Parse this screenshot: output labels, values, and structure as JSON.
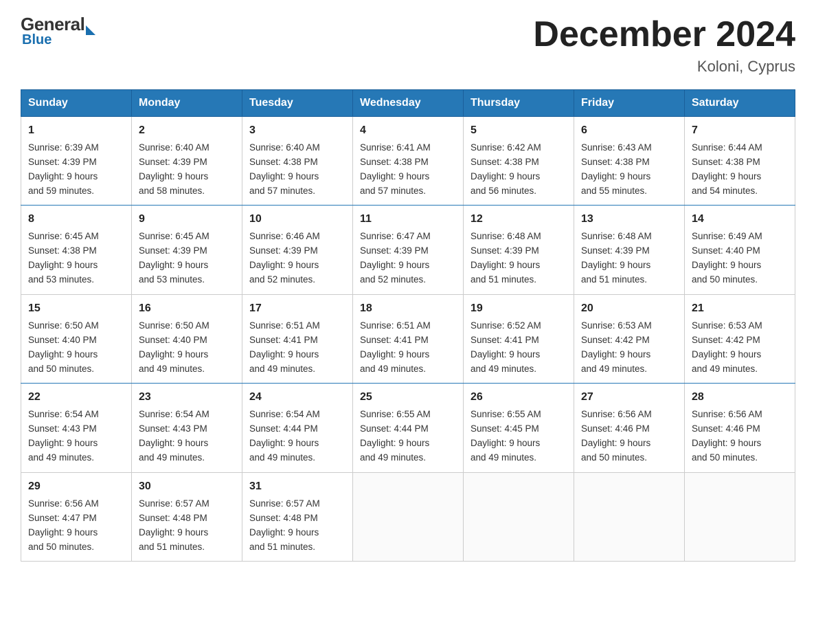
{
  "logo": {
    "general": "General",
    "blue": "Blue"
  },
  "title": "December 2024",
  "location": "Koloni, Cyprus",
  "days_of_week": [
    "Sunday",
    "Monday",
    "Tuesday",
    "Wednesday",
    "Thursday",
    "Friday",
    "Saturday"
  ],
  "weeks": [
    [
      {
        "day": "1",
        "sunrise": "6:39 AM",
        "sunset": "4:39 PM",
        "daylight": "9 hours and 59 minutes."
      },
      {
        "day": "2",
        "sunrise": "6:40 AM",
        "sunset": "4:39 PM",
        "daylight": "9 hours and 58 minutes."
      },
      {
        "day": "3",
        "sunrise": "6:40 AM",
        "sunset": "4:38 PM",
        "daylight": "9 hours and 57 minutes."
      },
      {
        "day": "4",
        "sunrise": "6:41 AM",
        "sunset": "4:38 PM",
        "daylight": "9 hours and 57 minutes."
      },
      {
        "day": "5",
        "sunrise": "6:42 AM",
        "sunset": "4:38 PM",
        "daylight": "9 hours and 56 minutes."
      },
      {
        "day": "6",
        "sunrise": "6:43 AM",
        "sunset": "4:38 PM",
        "daylight": "9 hours and 55 minutes."
      },
      {
        "day": "7",
        "sunrise": "6:44 AM",
        "sunset": "4:38 PM",
        "daylight": "9 hours and 54 minutes."
      }
    ],
    [
      {
        "day": "8",
        "sunrise": "6:45 AM",
        "sunset": "4:38 PM",
        "daylight": "9 hours and 53 minutes."
      },
      {
        "day": "9",
        "sunrise": "6:45 AM",
        "sunset": "4:39 PM",
        "daylight": "9 hours and 53 minutes."
      },
      {
        "day": "10",
        "sunrise": "6:46 AM",
        "sunset": "4:39 PM",
        "daylight": "9 hours and 52 minutes."
      },
      {
        "day": "11",
        "sunrise": "6:47 AM",
        "sunset": "4:39 PM",
        "daylight": "9 hours and 52 minutes."
      },
      {
        "day": "12",
        "sunrise": "6:48 AM",
        "sunset": "4:39 PM",
        "daylight": "9 hours and 51 minutes."
      },
      {
        "day": "13",
        "sunrise": "6:48 AM",
        "sunset": "4:39 PM",
        "daylight": "9 hours and 51 minutes."
      },
      {
        "day": "14",
        "sunrise": "6:49 AM",
        "sunset": "4:40 PM",
        "daylight": "9 hours and 50 minutes."
      }
    ],
    [
      {
        "day": "15",
        "sunrise": "6:50 AM",
        "sunset": "4:40 PM",
        "daylight": "9 hours and 50 minutes."
      },
      {
        "day": "16",
        "sunrise": "6:50 AM",
        "sunset": "4:40 PM",
        "daylight": "9 hours and 49 minutes."
      },
      {
        "day": "17",
        "sunrise": "6:51 AM",
        "sunset": "4:41 PM",
        "daylight": "9 hours and 49 minutes."
      },
      {
        "day": "18",
        "sunrise": "6:51 AM",
        "sunset": "4:41 PM",
        "daylight": "9 hours and 49 minutes."
      },
      {
        "day": "19",
        "sunrise": "6:52 AM",
        "sunset": "4:41 PM",
        "daylight": "9 hours and 49 minutes."
      },
      {
        "day": "20",
        "sunrise": "6:53 AM",
        "sunset": "4:42 PM",
        "daylight": "9 hours and 49 minutes."
      },
      {
        "day": "21",
        "sunrise": "6:53 AM",
        "sunset": "4:42 PM",
        "daylight": "9 hours and 49 minutes."
      }
    ],
    [
      {
        "day": "22",
        "sunrise": "6:54 AM",
        "sunset": "4:43 PM",
        "daylight": "9 hours and 49 minutes."
      },
      {
        "day": "23",
        "sunrise": "6:54 AM",
        "sunset": "4:43 PM",
        "daylight": "9 hours and 49 minutes."
      },
      {
        "day": "24",
        "sunrise": "6:54 AM",
        "sunset": "4:44 PM",
        "daylight": "9 hours and 49 minutes."
      },
      {
        "day": "25",
        "sunrise": "6:55 AM",
        "sunset": "4:44 PM",
        "daylight": "9 hours and 49 minutes."
      },
      {
        "day": "26",
        "sunrise": "6:55 AM",
        "sunset": "4:45 PM",
        "daylight": "9 hours and 49 minutes."
      },
      {
        "day": "27",
        "sunrise": "6:56 AM",
        "sunset": "4:46 PM",
        "daylight": "9 hours and 50 minutes."
      },
      {
        "day": "28",
        "sunrise": "6:56 AM",
        "sunset": "4:46 PM",
        "daylight": "9 hours and 50 minutes."
      }
    ],
    [
      {
        "day": "29",
        "sunrise": "6:56 AM",
        "sunset": "4:47 PM",
        "daylight": "9 hours and 50 minutes."
      },
      {
        "day": "30",
        "sunrise": "6:57 AM",
        "sunset": "4:48 PM",
        "daylight": "9 hours and 51 minutes."
      },
      {
        "day": "31",
        "sunrise": "6:57 AM",
        "sunset": "4:48 PM",
        "daylight": "9 hours and 51 minutes."
      },
      null,
      null,
      null,
      null
    ]
  ],
  "labels": {
    "sunrise": "Sunrise:",
    "sunset": "Sunset:",
    "daylight": "Daylight:"
  }
}
